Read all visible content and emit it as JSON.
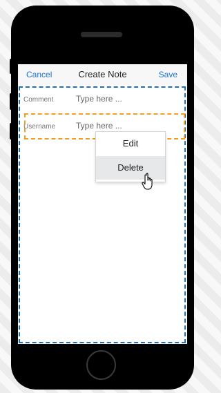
{
  "navbar": {
    "cancel_label": "Cancel",
    "title": "Create Note",
    "save_label": "Save"
  },
  "form": {
    "fields": [
      {
        "label": "Comment",
        "placeholder": "Type here ..."
      },
      {
        "label": "Username",
        "placeholder": "Type here ..."
      }
    ]
  },
  "context_menu": {
    "items": [
      {
        "label": "Edit"
      },
      {
        "label": "Delete"
      }
    ],
    "hovered_item": "Delete"
  },
  "colors": {
    "link": "#1a73d9",
    "form_outline": "#1f6fbf",
    "selected_outline": "#f0a020"
  },
  "icons": {
    "cursor": "hand-pointer-icon"
  }
}
